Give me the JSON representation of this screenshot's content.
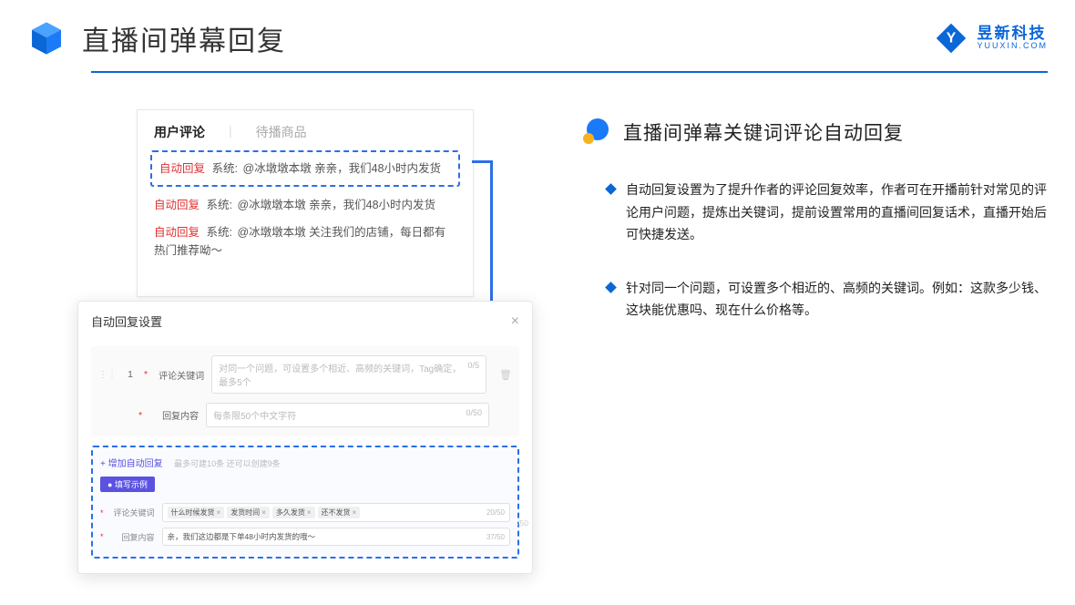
{
  "header": {
    "title": "直播间弹幕回复",
    "brand_cn": "昱新科技",
    "brand_en": "YUUXIN.COM"
  },
  "comments": {
    "tab_active": "用户评论",
    "tab_inactive": "待播商品",
    "rows": [
      {
        "badge": "自动回复",
        "system": "系统:",
        "text": "@冰墩墩本墩 亲亲，我们48小时内发货"
      },
      {
        "badge": "自动回复",
        "system": "系统:",
        "text": "@冰墩墩本墩 亲亲，我们48小时内发货"
      },
      {
        "badge": "自动回复",
        "system": "系统:",
        "text": "@冰墩墩本墩 关注我们的店铺，每日都有热门推荐呦～"
      }
    ]
  },
  "dialog": {
    "title": "自动回复设置",
    "order": "1",
    "keyword_label": "评论关键词",
    "keyword_placeholder": "对同一个问题，可设置多个相近、高频的关键词，Tag确定，最多5个",
    "keyword_counter": "0/5",
    "content_label": "回复内容",
    "content_placeholder": "每条限50个中文字符",
    "content_counter": "0/50",
    "add_link": "+ 增加自动回复",
    "add_hint": "最多可建10条 还可以创建9条",
    "example_badge": "● 填写示例",
    "ex_keyword_label": "评论关键词",
    "ex_tags": [
      "什么时候发货",
      "发货时间",
      "多久发货",
      "还不发货"
    ],
    "ex_keyword_counter": "20/50",
    "ex_content_label": "回复内容",
    "ex_content_value": "亲，我们这边都是下单48小时内发货的哦～",
    "ex_content_counter": "37/50",
    "far_counter": "/50"
  },
  "right": {
    "section_title": "直播间弹幕关键词评论自动回复",
    "bullets": [
      "自动回复设置为了提升作者的评论回复效率，作者可在开播前针对常见的评论用户问题，提炼出关键词，提前设置常用的直播间回复话术，直播开始后可快捷发送。",
      "针对同一个问题，可设置多个相近的、高频的关键词。例如：这款多少钱、这块能优惠吗、现在什么价格等。"
    ]
  }
}
